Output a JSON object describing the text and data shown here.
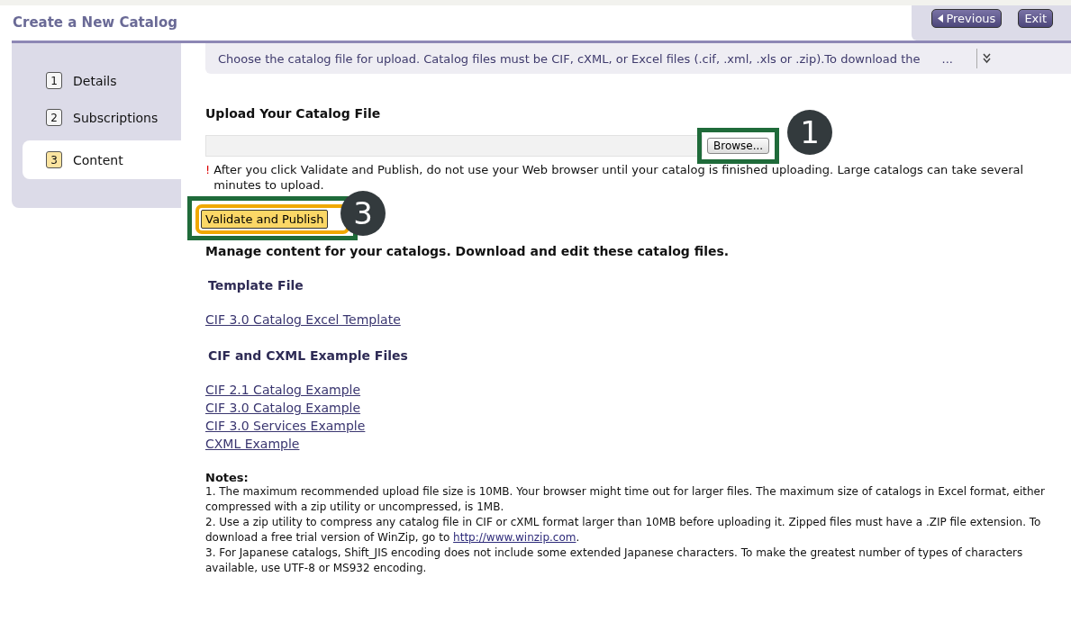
{
  "page_title": "Create a New Catalog",
  "header_buttons": [
    {
      "kind": "previous",
      "label": "Previous"
    },
    {
      "kind": "exit",
      "label": "Exit"
    }
  ],
  "steps": [
    {
      "number": "1",
      "label": "Details",
      "selected": false
    },
    {
      "number": "2",
      "label": "Subscriptions",
      "selected": false
    },
    {
      "number": "3",
      "label": "Content",
      "selected": true
    }
  ],
  "info_bar": {
    "text": "Choose the catalog file for upload. Catalog files must be CIF, cXML, or Excel files (.cif, .xml, .xls or .zip).To download the",
    "more": "..."
  },
  "upload": {
    "heading": "Upload Your Catalog File",
    "browse_label": "Browse...",
    "browse_callout": "1",
    "warning_mark": "!",
    "warning": "After you click Validate and Publish, do not use your Web browser until your catalog is finished uploading. Large catalogs can take several minutes to upload."
  },
  "validate": {
    "label": "Validate and Publish",
    "callout": "3"
  },
  "manage_heading": "Manage content for your catalogs. Download and edit these catalog files.",
  "sections": [
    {
      "heading": "Template File",
      "links": [
        "CIF 3.0 Catalog Excel Template"
      ]
    },
    {
      "heading": "CIF and CXML Example Files",
      "links": [
        "CIF 2.1 Catalog Example",
        "CIF 3.0 Catalog Example",
        "CIF 3.0 Services Example",
        "CXML Example"
      ]
    }
  ],
  "notes": {
    "heading": "Notes:",
    "items": [
      {
        "text": "1. The maximum recommended upload file size is 10MB. Your browser might time out for larger files. The maximum size of catalogs in Excel format, either compressed with a zip utility or uncompressed, is 1MB."
      },
      {
        "text": "2. Use a zip utility to compress any catalog file in CIF or cXML format larger than 10MB before uploading it. Zipped files must have a .ZIP file extension. To download a free trial version of WinZip, go to ",
        "link": "http://www.winzip.com",
        "after": "."
      },
      {
        "text": "3. For Japanese catalogs, Shift_JIS encoding does not include some extended Japanese characters. To make the greatest number of types of characters available, use UTF-8 or MS932 encoding."
      }
    ]
  }
}
